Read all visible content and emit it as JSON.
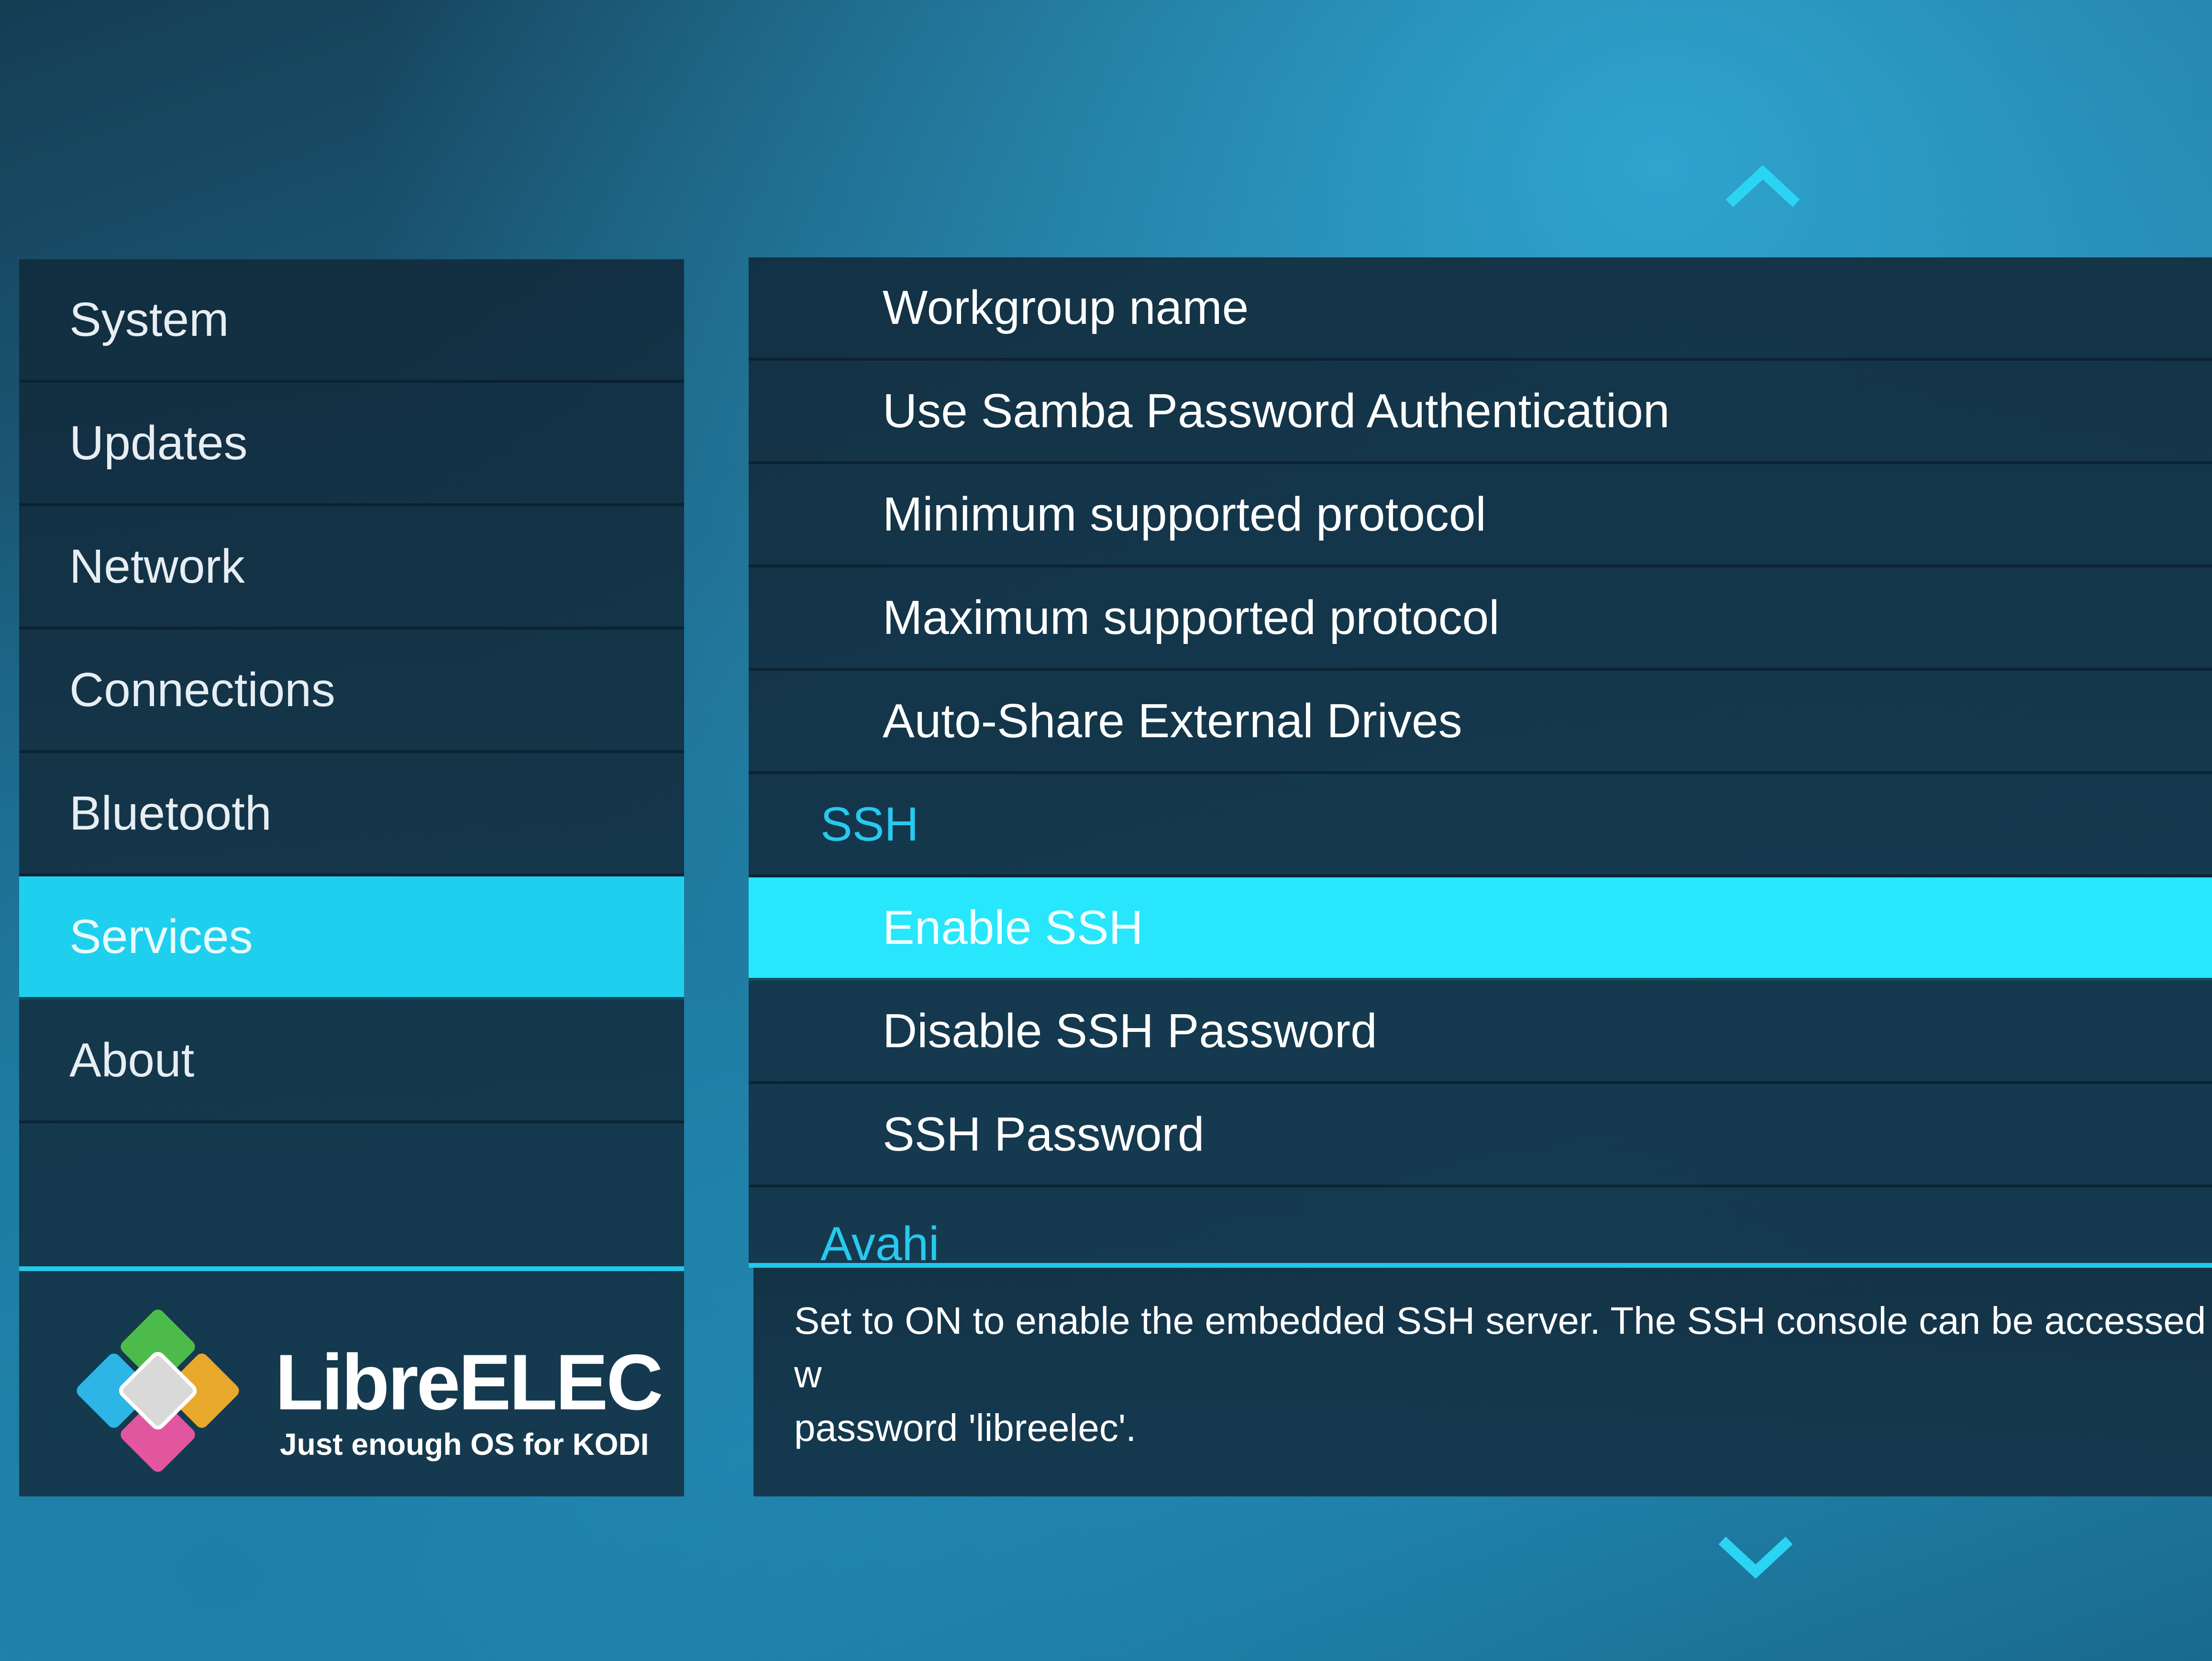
{
  "sidebar": {
    "items": [
      {
        "label": "System",
        "selected": false
      },
      {
        "label": "Updates",
        "selected": false
      },
      {
        "label": "Network",
        "selected": false
      },
      {
        "label": "Connections",
        "selected": false
      },
      {
        "label": "Bluetooth",
        "selected": false
      },
      {
        "label": "Services",
        "selected": true
      },
      {
        "label": "About",
        "selected": false
      }
    ]
  },
  "brand": {
    "name": "LibreELEC",
    "tagline": "Just enough OS for KODI",
    "logo_icon": "libreelec-logo-icon",
    "logo_colors": [
      "#4cbb4a",
      "#e8a82c",
      "#2db5e6",
      "#e256a0",
      "#d9d9d9"
    ]
  },
  "main": {
    "rows": [
      {
        "label": "Workgroup name",
        "type": "setting"
      },
      {
        "label": "Use Samba Password Authentication",
        "type": "setting"
      },
      {
        "label": "Minimum supported protocol",
        "type": "setting"
      },
      {
        "label": "Maximum supported protocol",
        "type": "setting"
      },
      {
        "label": "Auto-Share External Drives",
        "type": "setting"
      },
      {
        "label": "SSH",
        "type": "section"
      },
      {
        "label": "Enable SSH",
        "type": "setting",
        "selected": true
      },
      {
        "label": "Disable SSH Password",
        "type": "setting"
      },
      {
        "label": "SSH Password",
        "type": "setting"
      },
      {
        "label": "Avahi",
        "type": "section"
      }
    ]
  },
  "description": {
    "line1": "Set to ON to enable the embedded SSH server. The SSH console can be accessed w",
    "line2": "password 'libreelec'."
  },
  "navigation": {
    "up_icon": "chevron-up-icon",
    "down_icon": "chevron-down-icon"
  },
  "colors": {
    "accent": "#1fd0ee",
    "section_text": "#28c9ee",
    "panel": "#163a51",
    "text": "#ffffff"
  }
}
